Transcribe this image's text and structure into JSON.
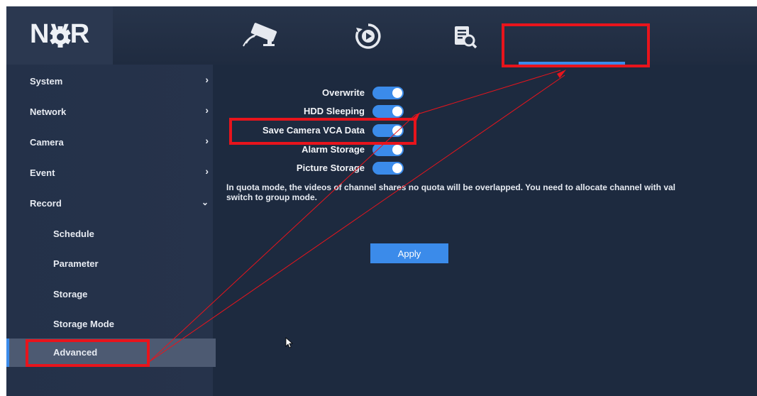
{
  "app": {
    "brand": "NVR"
  },
  "nav": {
    "icons": [
      "camera-icon",
      "playback-icon",
      "search-icon",
      "gear-icon"
    ],
    "active": "settings"
  },
  "sidebar": {
    "items": [
      {
        "label": "System",
        "expanded": false
      },
      {
        "label": "Network",
        "expanded": false
      },
      {
        "label": "Camera",
        "expanded": false
      },
      {
        "label": "Event",
        "expanded": false
      },
      {
        "label": "Record",
        "expanded": true
      }
    ],
    "record_sub": [
      {
        "label": "Schedule"
      },
      {
        "label": "Parameter"
      },
      {
        "label": "Storage"
      },
      {
        "label": "Storage Mode"
      },
      {
        "label": "Advanced",
        "selected": true
      }
    ]
  },
  "settings": [
    {
      "label": "Overwrite",
      "enabled": true
    },
    {
      "label": "HDD Sleeping",
      "enabled": true
    },
    {
      "label": "Save Camera VCA Data",
      "enabled": true
    },
    {
      "label": "Alarm Storage",
      "enabled": true
    },
    {
      "label": "Picture Storage",
      "enabled": true
    }
  ],
  "info": {
    "line1": "In quota mode, the videos of channel shares no quota will be overlapped. You need to allocate channel with val",
    "line2": "switch to group mode."
  },
  "apply_label": "Apply",
  "colors": {
    "background": "#1d2a3f",
    "accent": "#3b8bea",
    "annotation": "#e8141c"
  }
}
